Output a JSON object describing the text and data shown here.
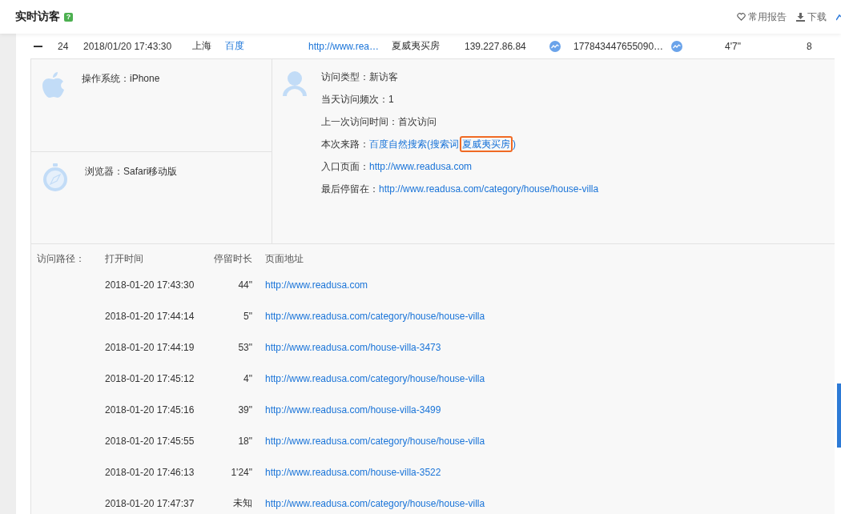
{
  "header": {
    "title": "实时访客",
    "help_badge": "?",
    "actions": [
      {
        "kind": "heart",
        "label": "常用报告"
      },
      {
        "kind": "download",
        "label": "下载"
      }
    ]
  },
  "visit_row": {
    "expanded": true,
    "index": "24",
    "time": "2018/01/20 17:43:30",
    "region": "上海",
    "source": "百度",
    "entry_url": "http://www.rea…",
    "keyword": "夏威夷买房",
    "ip": "139.227.86.84",
    "visitor_id": "177843447655090…",
    "duration": "4'7\"",
    "pages": "8"
  },
  "detail": {
    "os": {
      "label": "操作系统：",
      "value": "iPhone"
    },
    "browser": {
      "label": "浏览器：",
      "value": "Safari移动版"
    },
    "visit_info": [
      {
        "kind": "text",
        "label": "访问类型：",
        "value": "新访客"
      },
      {
        "kind": "text",
        "label": "当天访问频次：",
        "value": "1"
      },
      {
        "kind": "text",
        "label": "上一次访问时间：",
        "value": "首次访问"
      },
      {
        "kind": "source",
        "label": "本次来路：",
        "value": "百度自然搜索(搜索词",
        "highlight": "夏威夷买房",
        "suffix": ")"
      },
      {
        "kind": "link",
        "label": "入口页面：",
        "value": "http://www.readusa.com"
      },
      {
        "kind": "link",
        "label": "最后停留在：",
        "value": "http://www.readusa.com/category/house/house-villa"
      }
    ]
  },
  "path": {
    "label": "访问路径：",
    "columns": [
      "打开时间",
      "停留时长",
      "页面地址"
    ],
    "rows": [
      {
        "time": "2018-01-20 17:43:30",
        "duration": "44\"",
        "url": "http://www.readusa.com"
      },
      {
        "time": "2018-01-20 17:44:14",
        "duration": "5\"",
        "url": "http://www.readusa.com/category/house/house-villa"
      },
      {
        "time": "2018-01-20 17:44:19",
        "duration": "53\"",
        "url": "http://www.readusa.com/house-villa-3473"
      },
      {
        "time": "2018-01-20 17:45:12",
        "duration": "4\"",
        "url": "http://www.readusa.com/category/house/house-villa"
      },
      {
        "time": "2018-01-20 17:45:16",
        "duration": "39\"",
        "url": "http://www.readusa.com/house-villa-3499"
      },
      {
        "time": "2018-01-20 17:45:55",
        "duration": "18\"",
        "url": "http://www.readusa.com/category/house/house-villa"
      },
      {
        "time": "2018-01-20 17:46:13",
        "duration": "1'24\"",
        "url": "http://www.readusa.com/house-villa-3522"
      },
      {
        "time": "2018-01-20 17:47:37",
        "duration": "未知",
        "url": "http://www.readusa.com/category/house/house-villa"
      }
    ]
  }
}
